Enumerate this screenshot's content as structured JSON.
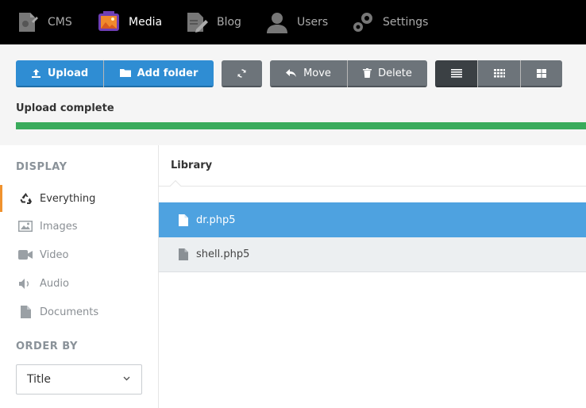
{
  "nav": {
    "items": [
      {
        "label": "CMS",
        "icon": "cms-document-icon"
      },
      {
        "label": "Media",
        "icon": "media-image-icon",
        "active": true
      },
      {
        "label": "Blog",
        "icon": "blog-pencil-icon"
      },
      {
        "label": "Users",
        "icon": "user-icon"
      },
      {
        "label": "Settings",
        "icon": "gears-icon"
      }
    ],
    "active_color": "#ffffff",
    "inactive_color": "#aaaaaa"
  },
  "toolbar": {
    "upload_label": "Upload",
    "add_folder_label": "Add folder",
    "move_label": "Move",
    "delete_label": "Delete",
    "refresh_icon": "refresh-icon",
    "view_modes": [
      "list-view-icon",
      "small-grid-icon",
      "large-grid-icon"
    ],
    "accent_color": "#2f8dd3"
  },
  "upload": {
    "status": "Upload complete",
    "progress_percent": 100,
    "progress_color": "#3aab5c"
  },
  "sidebar": {
    "display_heading": "DISPLAY",
    "items": [
      {
        "label": "Everything",
        "icon": "recycle-icon",
        "active": true
      },
      {
        "label": "Images",
        "icon": "image-icon"
      },
      {
        "label": "Video",
        "icon": "video-camera-icon"
      },
      {
        "label": "Audio",
        "icon": "speaker-icon"
      },
      {
        "label": "Documents",
        "icon": "document-icon"
      }
    ],
    "order_heading": "ORDER BY",
    "order_value": "Title",
    "active_marker_color": "#f0922e"
  },
  "library": {
    "title": "Library",
    "files": [
      {
        "name": "dr.php5",
        "selected": true
      },
      {
        "name": "shell.php5",
        "selected": false
      }
    ],
    "selected_color": "#4ea2e0"
  }
}
